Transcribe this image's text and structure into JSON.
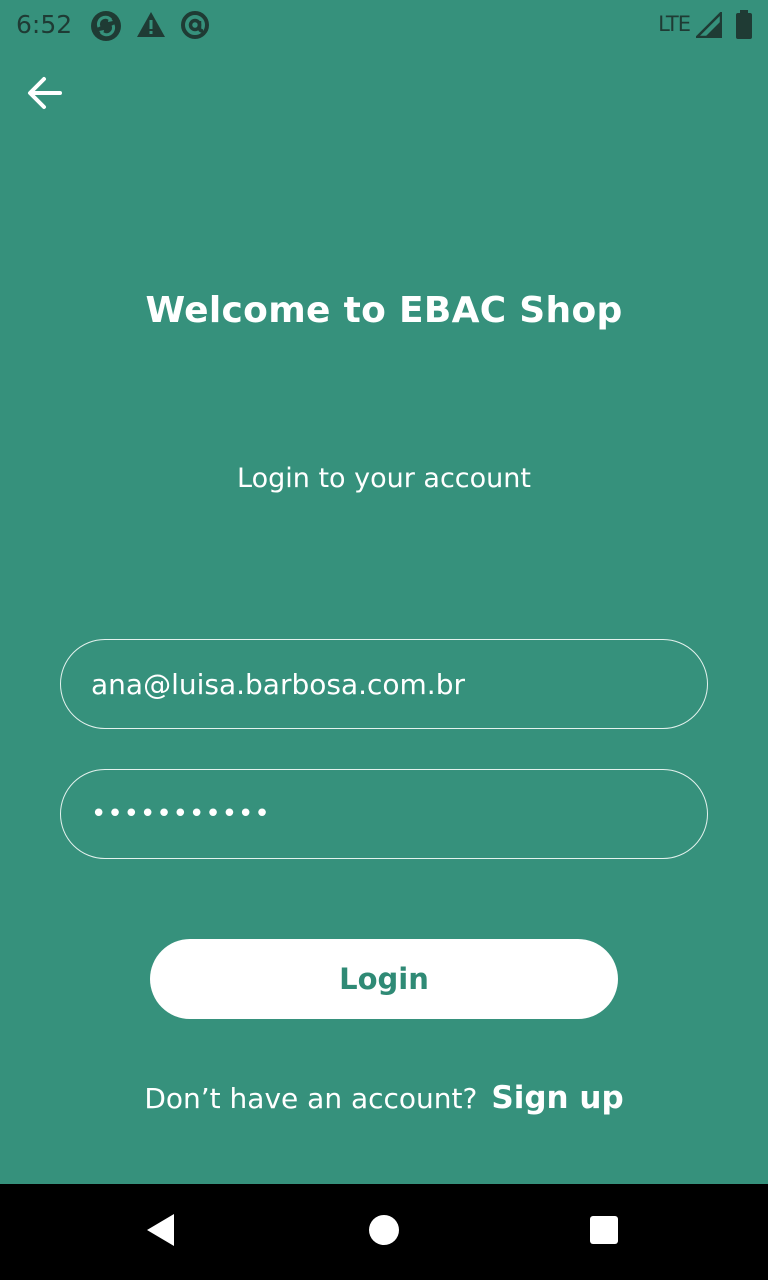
{
  "status_bar": {
    "time": "6:52",
    "network": "LTE",
    "notification_icons": [
      "sync-icon",
      "warning-icon",
      "at-sign-icon"
    ]
  },
  "header": {
    "back_icon": "arrow-left-icon"
  },
  "main": {
    "title": "Welcome to EBAC Shop",
    "subtitle": "Login to your account",
    "email_value": "ana@luisa.barbosa.com.br",
    "password_value": "•••••••••••",
    "login_label": "Login",
    "signup_prompt": "Don’t have an account?",
    "signup_label": "Sign up"
  },
  "nav_bar": {
    "buttons": [
      "back-triangle-icon",
      "home-circle-icon",
      "recents-square-icon"
    ]
  },
  "colors": {
    "background": "#36917c",
    "accent_text": "#2f8a75",
    "status_icons": "#1f3b34"
  }
}
